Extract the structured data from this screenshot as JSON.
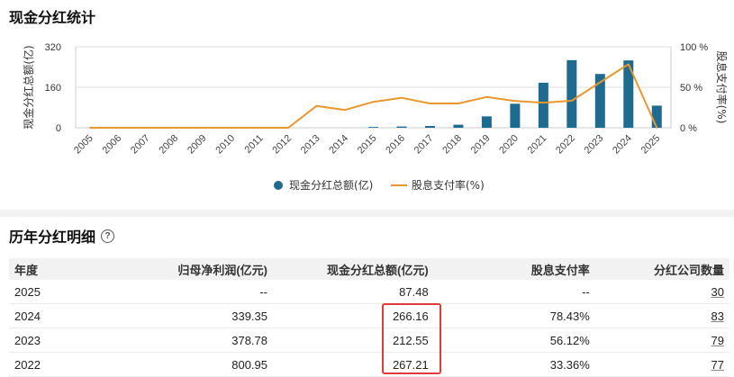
{
  "chart_section": {
    "title": "现金分红统计"
  },
  "detail_section": {
    "title": "历年分红明细",
    "help_icon": "question-circle-icon"
  },
  "colors": {
    "bar": "#1f6a8f",
    "line": "#e8972e",
    "highlight": "#e03a3a"
  },
  "chart_data": {
    "type": "bar+line",
    "categories": [
      "2005",
      "2006",
      "2007",
      "2008",
      "2009",
      "2010",
      "2011",
      "2012",
      "2013",
      "2014",
      "2015",
      "2016",
      "2017",
      "2018",
      "2019",
      "2020",
      "2021",
      "2022",
      "2023",
      "2024",
      "2025"
    ],
    "series": [
      {
        "name": "现金分红总额(亿)",
        "type": "bar",
        "axis": "left",
        "values": [
          0,
          0,
          0,
          0,
          0,
          0,
          0,
          0,
          0,
          0,
          3,
          5,
          7,
          12,
          45,
          95,
          178,
          267.21,
          212.55,
          266.16,
          87.48
        ]
      },
      {
        "name": "股息支付率(%)",
        "type": "line",
        "axis": "right",
        "values": [
          0,
          0,
          0,
          0,
          0,
          0,
          0,
          0,
          27,
          22,
          32,
          37,
          30,
          30,
          38,
          33,
          31,
          33.36,
          56.12,
          78.43,
          0
        ]
      }
    ],
    "ylabel": "现金分红总额(亿)",
    "y2label": "股息支付率(%)",
    "ylim": [
      0,
      320
    ],
    "y2lim": [
      0,
      100
    ],
    "yticks": [
      "0",
      "160",
      "320"
    ],
    "y2ticks": [
      "0 %",
      "50 %",
      "100 %"
    ],
    "grid": true,
    "legend_position": "bottom-center"
  },
  "table": {
    "headers": [
      "年度",
      "归母净利润(亿元)",
      "现金分红总额(亿元)",
      "股息支付率",
      "分红公司数量"
    ],
    "rows": [
      [
        "2025",
        "--",
        "87.48",
        "--",
        "30"
      ],
      [
        "2024",
        "339.35",
        "266.16",
        "78.43%",
        "83"
      ],
      [
        "2023",
        "378.78",
        "212.55",
        "56.12%",
        "79"
      ],
      [
        "2022",
        "800.95",
        "267.21",
        "33.36%",
        "77"
      ]
    ]
  }
}
